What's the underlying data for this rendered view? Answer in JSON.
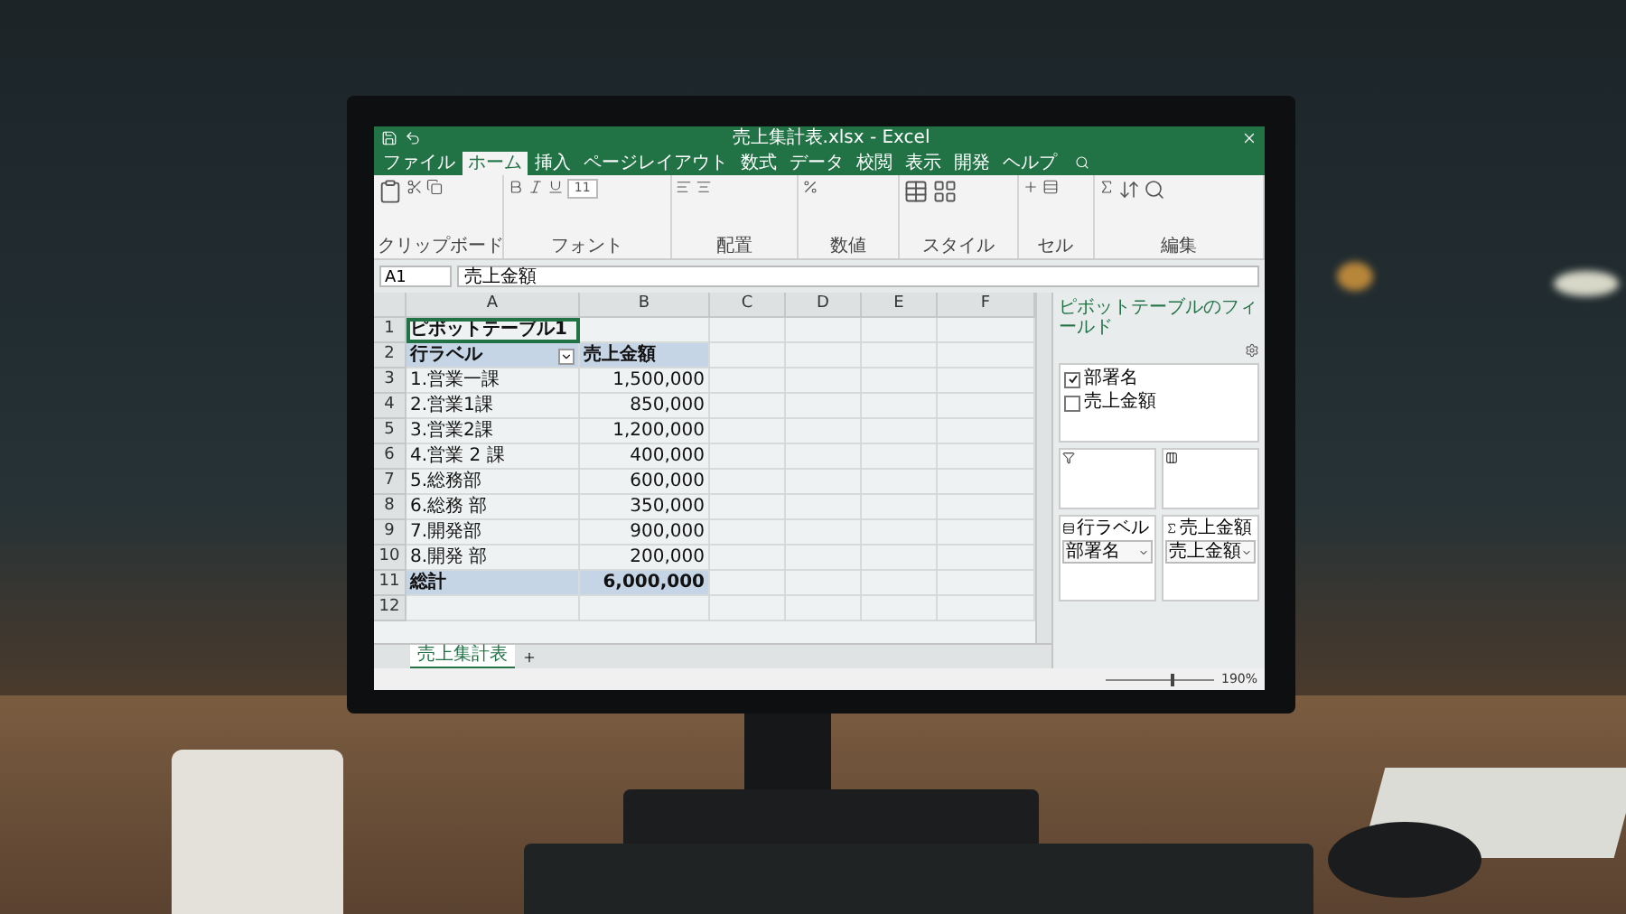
{
  "window": {
    "title": "売上集計表.xlsx - Excel"
  },
  "ribbon_tabs": [
    {
      "label": "ファイル",
      "selected": false
    },
    {
      "label": "ホーム",
      "selected": true
    },
    {
      "label": "挿入",
      "selected": false
    },
    {
      "label": "ページレイアウト",
      "selected": false
    },
    {
      "label": "数式",
      "selected": false
    },
    {
      "label": "データ",
      "selected": false
    },
    {
      "label": "校閲",
      "selected": false
    },
    {
      "label": "表示",
      "selected": false
    },
    {
      "label": "開発",
      "selected": false
    },
    {
      "label": "ヘルプ",
      "selected": false
    }
  ],
  "ribbon_groups": [
    "クリップボード",
    "フォント",
    "配置",
    "数値",
    "スタイル",
    "セル",
    "編集"
  ],
  "font_size": "11",
  "formula_bar": {
    "name_box": "A1",
    "formula": "売上金額"
  },
  "columns": [
    "A",
    "B",
    "C",
    "D",
    "E",
    "F"
  ],
  "rows": [
    {
      "number": "1",
      "kind": "title",
      "label": "ピボットテーブル1",
      "selected": true
    },
    {
      "number": "2",
      "kind": "header",
      "label": "行ラベル",
      "value": "売上金額",
      "selected": false
    },
    {
      "number": "3",
      "kind": "item",
      "label": "1.営業一課",
      "value": "1,500,000",
      "selected": false
    },
    {
      "number": "4",
      "kind": "item",
      "label": "2.営業1課",
      "value": "850,000",
      "selected": false
    },
    {
      "number": "5",
      "kind": "item",
      "label": "3.営業2課",
      "value": "1,200,000",
      "selected": false
    },
    {
      "number": "6",
      "kind": "item",
      "label": "4.営業 2 課",
      "value": "400,000",
      "selected": false
    },
    {
      "number": "7",
      "kind": "item",
      "label": "5.総務部",
      "value": "600,000",
      "selected": false
    },
    {
      "number": "8",
      "kind": "item",
      "label": "6.総務 部",
      "value": "350,000",
      "selected": false
    },
    {
      "number": "9",
      "kind": "item",
      "label": "7.開発部",
      "value": "900,000",
      "selected": false
    },
    {
      "number": "10",
      "kind": "item",
      "label": "8.開発 部",
      "value": "200,000",
      "selected": false
    },
    {
      "number": "11",
      "kind": "total",
      "label": "総計",
      "value": "6,000,000",
      "selected": false
    },
    {
      "number": "12",
      "kind": "empty",
      "selected": false
    }
  ],
  "sheet_tabs": [
    {
      "label": "売上集計表",
      "selected": true
    }
  ],
  "status_bar": {
    "zoom": "190%",
    "level": 0.6
  },
  "pivot_pane": {
    "title": "ピボットテーブルのフィールド",
    "fields": [
      {
        "label": "部署名",
        "checked": true
      },
      {
        "label": "売上金額",
        "checked": false
      }
    ],
    "rows_area": {
      "label": "行ラベル",
      "item": "部署名"
    },
    "values_area": {
      "label": "売上金額",
      "item": "売上金額"
    }
  }
}
